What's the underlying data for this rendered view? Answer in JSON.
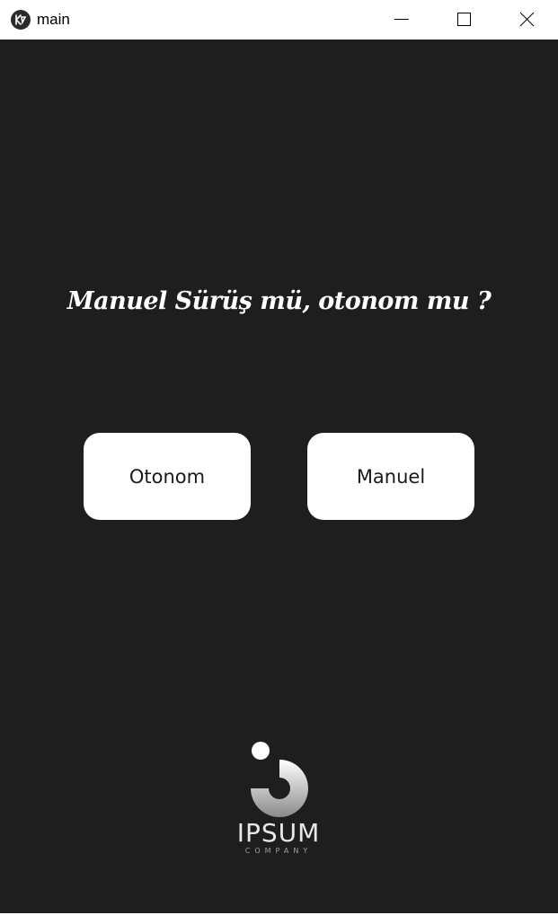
{
  "window": {
    "title": "main",
    "app_icon": "kivy-app-icon",
    "controls": {
      "minimize_icon": "minimize-icon",
      "maximize_icon": "maximize-icon",
      "close_icon": "close-icon"
    }
  },
  "main": {
    "question": "Manuel Sürüş mü, otonom mu ?",
    "buttons": {
      "otonom": "Otonom",
      "manuel": "Manuel"
    }
  },
  "logo": {
    "name": "IPSUM",
    "subtitle": "COMPANY"
  },
  "colors": {
    "background": "#1e1e1e",
    "button_bg": "#ffffff",
    "text_light": "#ffffff",
    "titlebar_bg": "#ffffff"
  }
}
